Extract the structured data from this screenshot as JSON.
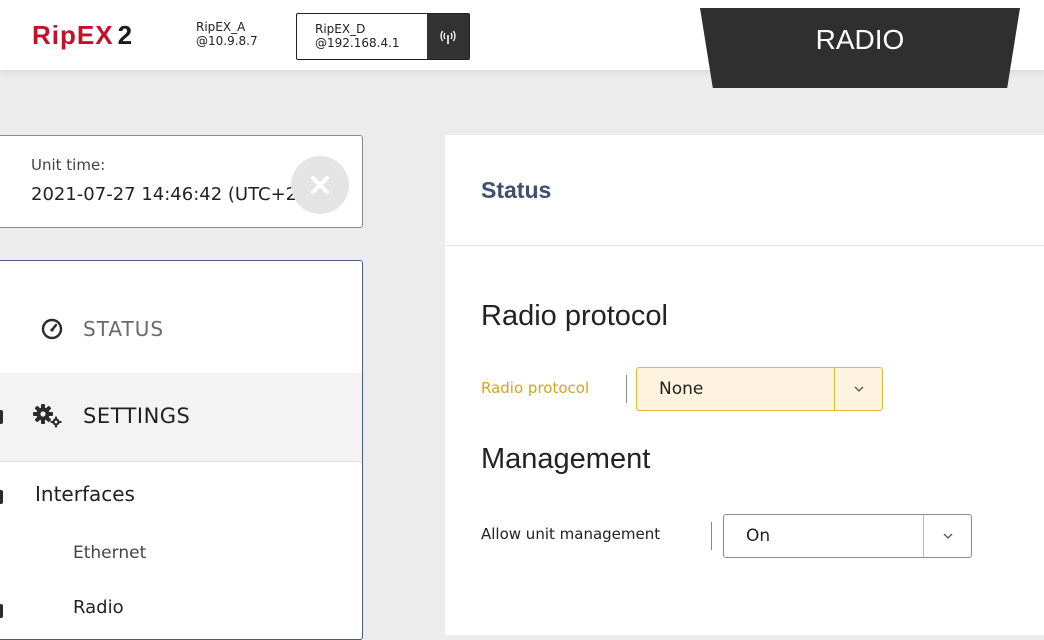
{
  "header": {
    "logo_main": "RipEX",
    "logo_num": "2",
    "unit_a_name": "RipEX_A",
    "unit_a_ip": "@10.9.8.7",
    "unit_d_name": "RipEX_D",
    "unit_d_ip": "@192.168.4.1",
    "mode_tab": "RADIO"
  },
  "unit_time": {
    "label": "Unit time:",
    "value": "2021-07-27 14:46:42 (UTC+2)"
  },
  "menu": {
    "status": "STATUS",
    "settings": "SETTINGS",
    "interfaces": "Interfaces",
    "ethernet": "Ethernet",
    "radio": "Radio"
  },
  "panel": {
    "title": "Status",
    "radio_protocol": {
      "heading": "Radio protocol",
      "field_label": "Radio protocol",
      "value": "None"
    },
    "management": {
      "heading": "Management",
      "field_label": "Allow unit management",
      "value": "On"
    }
  },
  "colors": {
    "brand_red": "#c4102a",
    "highlight": "#d9a21d",
    "title_blue": "#3d4f6b"
  }
}
